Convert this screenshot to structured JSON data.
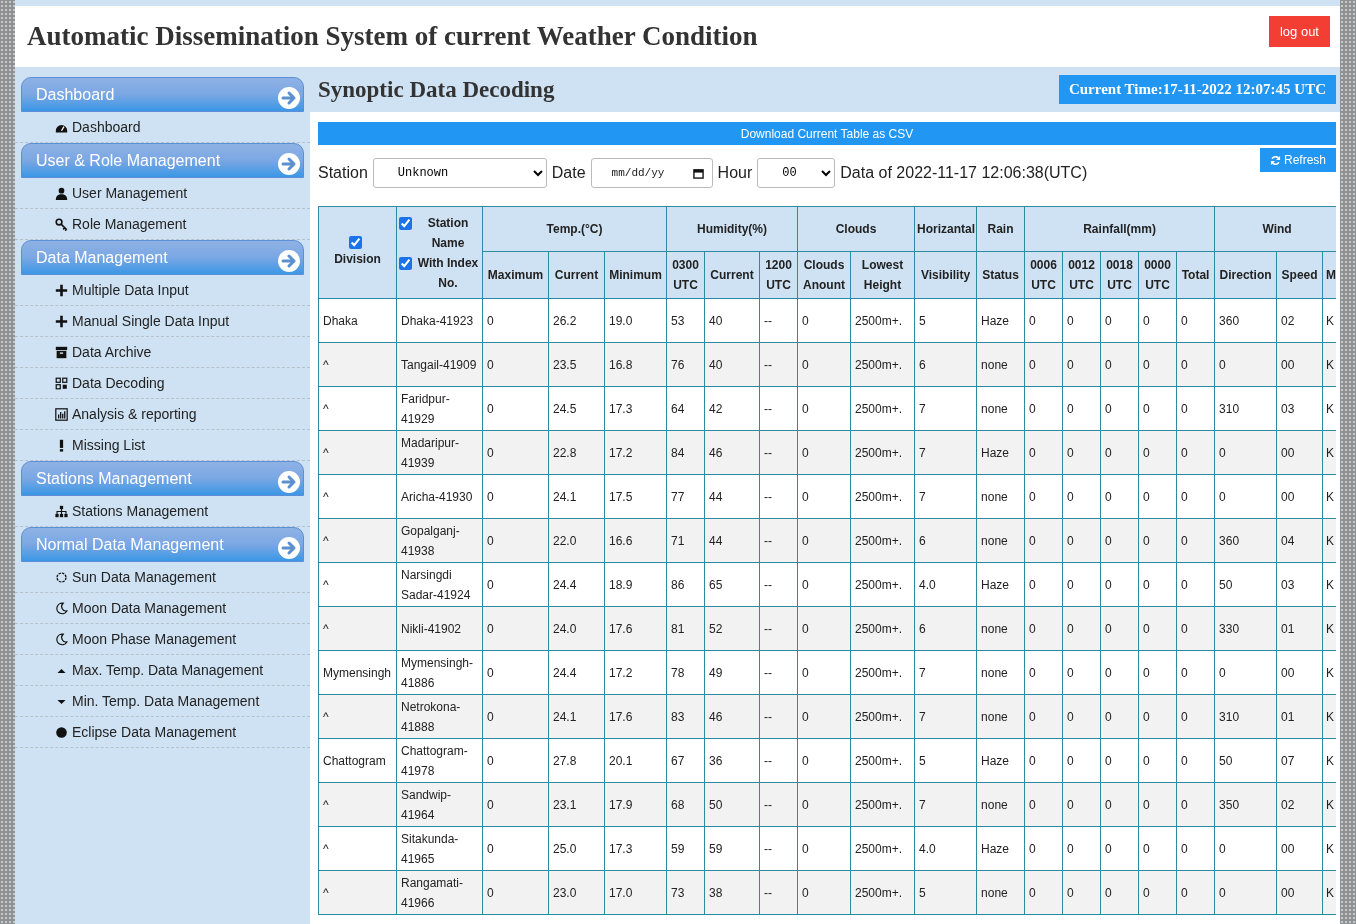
{
  "header": {
    "title": "Automatic Dissemination System of current Weather Condition",
    "logout": "log out"
  },
  "sidebar": {
    "sections": [
      {
        "title": "Dashboard",
        "items": [
          "Dashboard"
        ]
      },
      {
        "title": "User & Role Management",
        "items": [
          "User Management",
          "Role Management"
        ]
      },
      {
        "title": "Data Management",
        "items": [
          "Multiple Data Input",
          "Manual Single Data Input",
          "Data Archive",
          "Data Decoding",
          "Analysis & reporting",
          "Missing List"
        ]
      },
      {
        "title": "Stations Management",
        "items": [
          "Stations Management"
        ]
      },
      {
        "title": "Normal Data Management",
        "items": [
          "Sun Data Management",
          "Moon Data Management",
          "Moon Phase Management",
          "Max. Temp. Data Management",
          "Min. Temp. Data Management",
          "Eclipse Data Management"
        ]
      }
    ]
  },
  "main": {
    "title": "Synoptic Data Decoding",
    "current_time": "Current Time:17-11-2022 12:07:45 UTC",
    "download": "Download Current Table as CSV",
    "refresh": "Refresh",
    "filters": {
      "station_label": "Station",
      "station_value": "Unknown",
      "date_label": "Date",
      "date_placeholder": "mm/dd/yy",
      "hour_label": "Hour",
      "hour_value": "00",
      "data_of": "Data of 2022-11-17 12:06:38(UTC)"
    }
  },
  "table": {
    "division": {
      "label": "Division",
      "checked": true
    },
    "station": {
      "label_1": "Station Name",
      "checked_1": true,
      "label_2": "With Index No.",
      "checked_2": true
    },
    "groups": [
      {
        "label": "Temp.(°C)",
        "columns": [
          "Maximum",
          "Current",
          "Minimum"
        ]
      },
      {
        "label": "Humidity(%)",
        "columns": [
          "0300 UTC",
          "Current",
          "1200 UTC"
        ]
      },
      {
        "label": "Clouds",
        "columns": [
          "Clouds Anount",
          "Lowest Height"
        ]
      },
      {
        "label": "Horizantal",
        "columns": [
          "Visibility"
        ]
      },
      {
        "label": "Rain",
        "columns": [
          "Status"
        ]
      },
      {
        "label": "Rainfall(mm)",
        "columns": [
          "0006 UTC",
          "0012 UTC",
          "0018 UTC",
          "0000 UTC",
          "Total"
        ]
      },
      {
        "label": "Wind",
        "columns": [
          "Direction",
          "Speed",
          "M"
        ]
      }
    ],
    "rows": [
      [
        "Dhaka",
        "Dhaka-41923",
        "0",
        "26.2",
        "19.0",
        "53",
        "40",
        "--",
        "0",
        "2500m+.",
        "5",
        "Haze",
        "0",
        "0",
        "0",
        "0",
        "0",
        "360",
        "02",
        "K"
      ],
      [
        "^",
        "Tangail-41909",
        "0",
        "23.5",
        "16.8",
        "76",
        "40",
        "--",
        "0",
        "2500m+.",
        "6",
        "none",
        "0",
        "0",
        "0",
        "0",
        "0",
        "0",
        "00",
        "K"
      ],
      [
        "^",
        "Faridpur-41929",
        "0",
        "24.5",
        "17.3",
        "64",
        "42",
        "--",
        "0",
        "2500m+.",
        "7",
        "none",
        "0",
        "0",
        "0",
        "0",
        "0",
        "310",
        "03",
        "K"
      ],
      [
        "^",
        "Madaripur-41939",
        "0",
        "22.8",
        "17.2",
        "84",
        "46",
        "--",
        "0",
        "2500m+.",
        "7",
        "Haze",
        "0",
        "0",
        "0",
        "0",
        "0",
        "0",
        "00",
        "K"
      ],
      [
        "^",
        "Aricha-41930",
        "0",
        "24.1",
        "17.5",
        "77",
        "44",
        "--",
        "0",
        "2500m+.",
        "7",
        "none",
        "0",
        "0",
        "0",
        "0",
        "0",
        "0",
        "00",
        "K"
      ],
      [
        "^",
        "Gopalganj-41938",
        "0",
        "22.0",
        "16.6",
        "71",
        "44",
        "--",
        "0",
        "2500m+.",
        "6",
        "none",
        "0",
        "0",
        "0",
        "0",
        "0",
        "360",
        "04",
        "K"
      ],
      [
        "^",
        "Narsingdi Sadar-41924",
        "0",
        "24.4",
        "18.9",
        "86",
        "65",
        "--",
        "0",
        "2500m+.",
        "4.0",
        "Haze",
        "0",
        "0",
        "0",
        "0",
        "0",
        "50",
        "03",
        "K"
      ],
      [
        "^",
        "Nikli-41902",
        "0",
        "24.0",
        "17.6",
        "81",
        "52",
        "--",
        "0",
        "2500m+.",
        "6",
        "none",
        "0",
        "0",
        "0",
        "0",
        "0",
        "330",
        "01",
        "K"
      ],
      [
        "Mymensingh",
        "Mymensingh-41886",
        "0",
        "24.4",
        "17.2",
        "78",
        "49",
        "--",
        "0",
        "2500m+.",
        "7",
        "none",
        "0",
        "0",
        "0",
        "0",
        "0",
        "0",
        "00",
        "K"
      ],
      [
        "^",
        "Netrokona-41888",
        "0",
        "24.1",
        "17.6",
        "83",
        "46",
        "--",
        "0",
        "2500m+.",
        "7",
        "none",
        "0",
        "0",
        "0",
        "0",
        "0",
        "310",
        "01",
        "K"
      ],
      [
        "Chattogram",
        "Chattogram-41978",
        "0",
        "27.8",
        "20.1",
        "67",
        "36",
        "--",
        "0",
        "2500m+.",
        "5",
        "Haze",
        "0",
        "0",
        "0",
        "0",
        "0",
        "50",
        "07",
        "K"
      ],
      [
        "^",
        "Sandwip-41964",
        "0",
        "23.1",
        "17.9",
        "68",
        "50",
        "--",
        "0",
        "2500m+.",
        "7",
        "none",
        "0",
        "0",
        "0",
        "0",
        "0",
        "350",
        "02",
        "K"
      ],
      [
        "^",
        "Sitakunda-41965",
        "0",
        "25.0",
        "17.3",
        "59",
        "59",
        "--",
        "0",
        "2500m+.",
        "4.0",
        "Haze",
        "0",
        "0",
        "0",
        "0",
        "0",
        "0",
        "00",
        "K"
      ],
      [
        "^",
        "Rangamati-41966",
        "0",
        "23.0",
        "17.0",
        "73",
        "38",
        "--",
        "0",
        "2500m+.",
        "5",
        "none",
        "0",
        "0",
        "0",
        "0",
        "0",
        "0",
        "00",
        "K"
      ]
    ]
  }
}
